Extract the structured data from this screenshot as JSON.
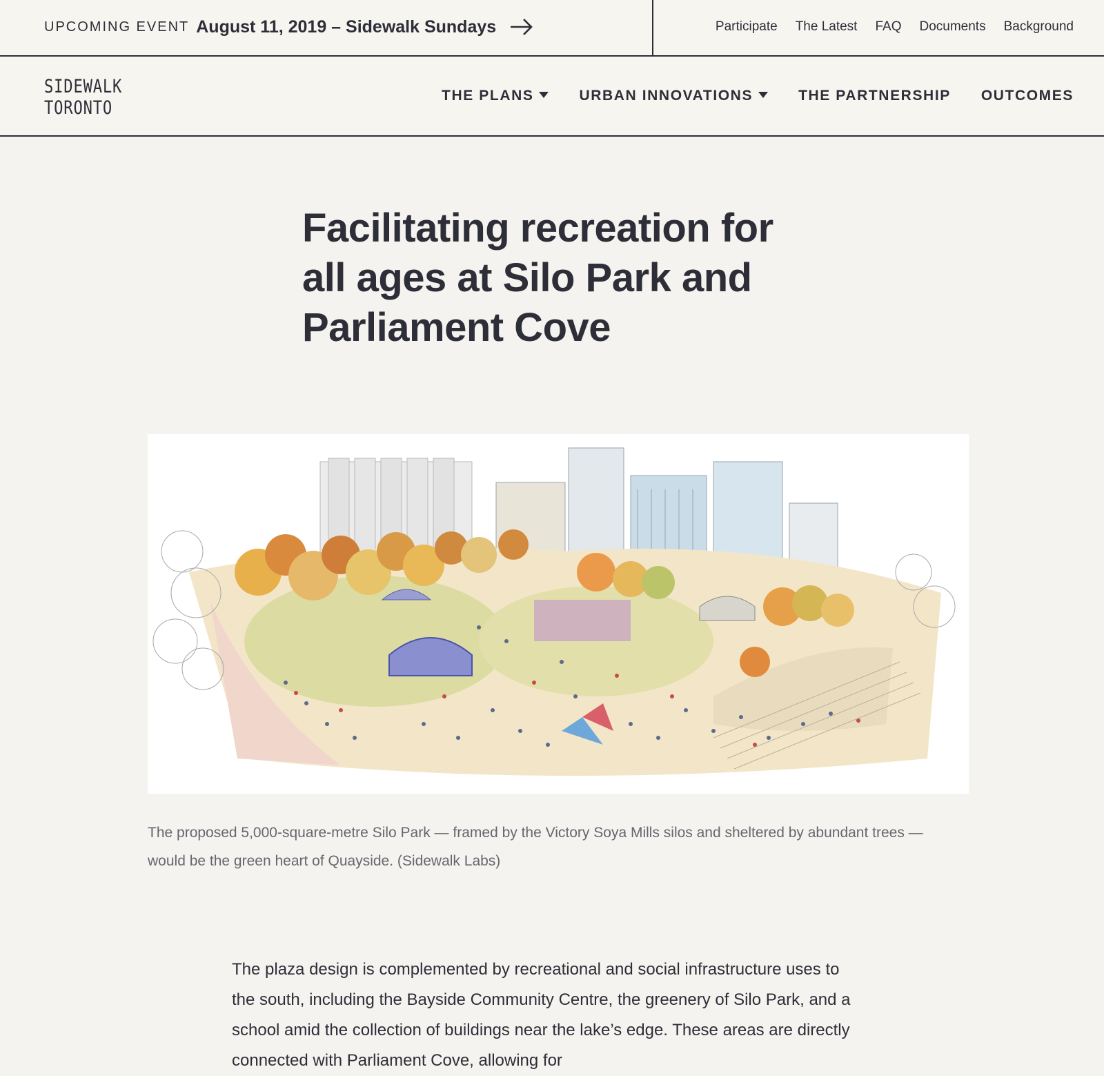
{
  "event_bar": {
    "label": "UPCOMING EVENT",
    "title": "August 11, 2019 – Sidewalk Sundays",
    "arrow_icon": "arrow-right-icon"
  },
  "utility_nav": [
    "Participate",
    "The Latest",
    "FAQ",
    "Documents",
    "Background"
  ],
  "logo": {
    "line1": "SIDEWALK",
    "line2": "TORONTO"
  },
  "main_nav": [
    {
      "label": "THE PLANS",
      "dropdown": true
    },
    {
      "label": "URBAN INNOVATIONS",
      "dropdown": true
    },
    {
      "label": "THE PARTNERSHIP",
      "dropdown": false
    },
    {
      "label": "OUTCOMES",
      "dropdown": false
    }
  ],
  "article": {
    "headline": "Facilitating recreation for all ages at Silo Park and Parliament Cove",
    "caption": "The proposed 5,000-square-metre Silo Park — framed by the Victory Soya Mills silos and sheltered by abundant trees — would be the green heart of Quayside. (Sidewalk Labs)",
    "body": "The plaza design is complemented by recreational and social infrastructure uses to the south, including the Bayside Community Centre, the greenery of Silo Park, and a school amid the collection of buildings near the lake’s edge. These areas are directly connected with Parliament Cove, allowing for"
  },
  "colors": {
    "ink": "#2e2e38",
    "page_background": "#f5f3ef",
    "caption": "#66666e"
  }
}
